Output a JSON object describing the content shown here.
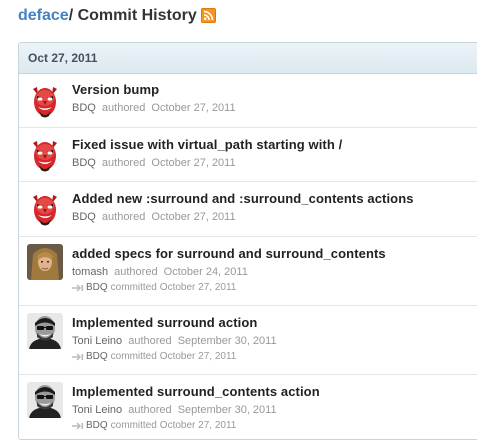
{
  "header": {
    "repo": "deface",
    "separator_title": " / Commit History",
    "icon": "rss-icon"
  },
  "group": {
    "date": "Oct 27, 2011"
  },
  "commits": [
    {
      "message": "Version bump",
      "author": "BDQ",
      "action": "authored",
      "date": "October 27, 2011",
      "avatar": "devil-mask-avatar"
    },
    {
      "message": "Fixed issue with virtual_path starting with /",
      "author": "BDQ",
      "action": "authored",
      "date": "October 27, 2011",
      "avatar": "devil-mask-avatar"
    },
    {
      "message": "Added new :surround and :surround_contents actions",
      "author": "BDQ",
      "action": "authored",
      "date": "October 27, 2011",
      "avatar": "devil-mask-avatar"
    },
    {
      "message": "added specs for surround and surround_contents",
      "author": "tomash",
      "action": "authored",
      "date": "October 24, 2011",
      "committer": "BDQ",
      "committer_action": "committed",
      "committer_date": "October 27, 2011",
      "avatar": "long-hair-avatar"
    },
    {
      "message": "Implemented surround action",
      "author": "Toni Leino",
      "action": "authored",
      "date": "September 30, 2011",
      "committer": "BDQ",
      "committer_action": "committed",
      "committer_date": "October 27, 2011",
      "avatar": "bw-photo-avatar"
    },
    {
      "message": "Implemented surround_contents action",
      "author": "Toni Leino",
      "action": "authored",
      "date": "September 30, 2011",
      "committer": "BDQ",
      "committer_action": "committed",
      "committer_date": "October 27, 2011",
      "avatar": "bw-photo-avatar"
    }
  ],
  "colors": {
    "link": "#4183c4",
    "date_header_bg": "#e3eef5",
    "rss": "#f79421"
  }
}
